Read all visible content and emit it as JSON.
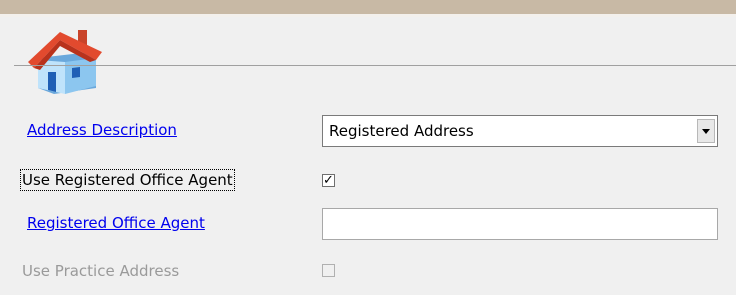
{
  "header": {
    "icon": "house-icon"
  },
  "form": {
    "address_description": {
      "label": "Address Description",
      "value": "Registered Address"
    },
    "use_registered_office_agent": {
      "label": "Use Registered Office Agent",
      "checked": true,
      "mark": "✓"
    },
    "registered_office_agent": {
      "label": "Registered Office Agent",
      "value": ""
    },
    "use_practice_address": {
      "label": "Use Practice Address",
      "checked": false,
      "enabled": false
    }
  },
  "colors": {
    "link": "#0000ee",
    "disabled_text": "#9a9a9a",
    "background": "#f0f0f0",
    "top_bar": "#c8b9a5"
  }
}
